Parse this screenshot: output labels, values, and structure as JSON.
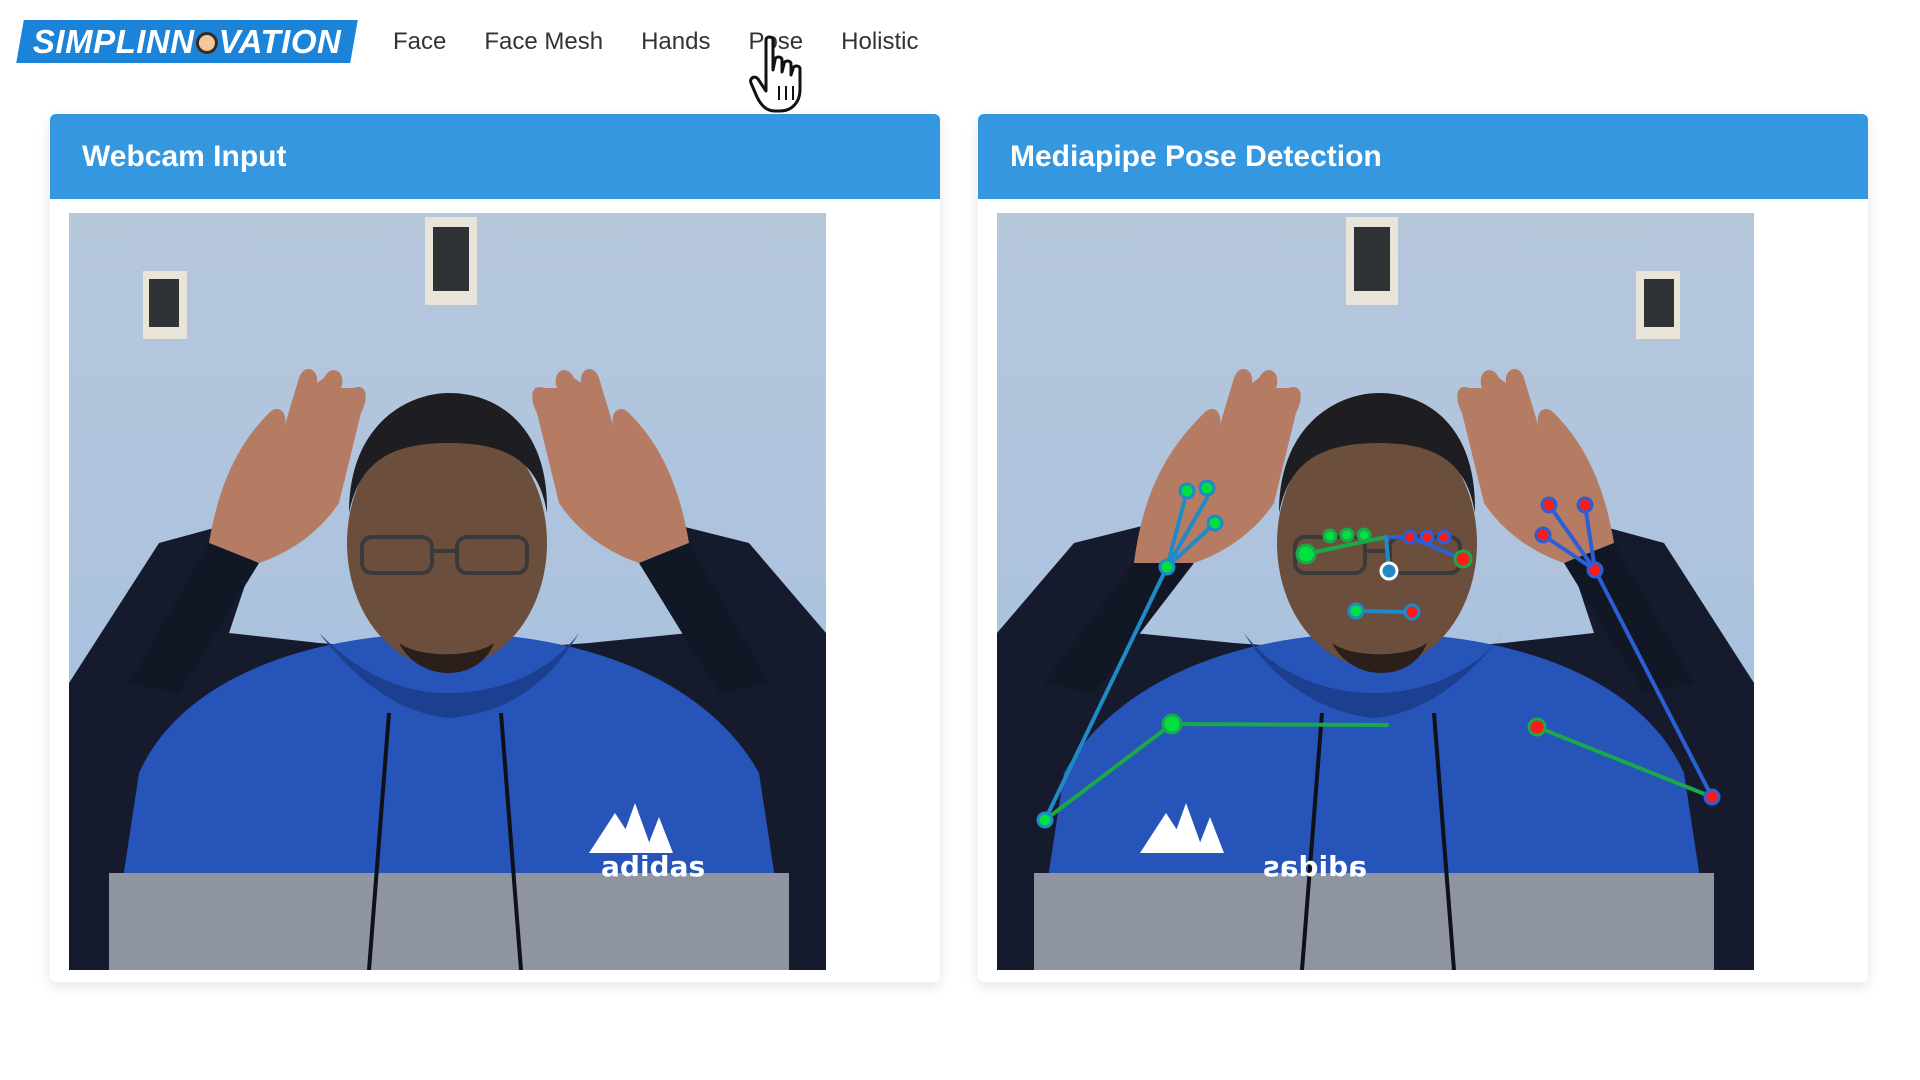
{
  "brand": {
    "text_before": "SIMPLINN",
    "text_after": "VATION"
  },
  "nav": {
    "items": [
      {
        "label": "Face"
      },
      {
        "label": "Face Mesh"
      },
      {
        "label": "Hands"
      },
      {
        "label": "Pose"
      },
      {
        "label": "Holistic"
      }
    ],
    "hovered": "Pose"
  },
  "panels": {
    "webcam": {
      "title": "Webcam Input"
    },
    "pose": {
      "title": "Mediapipe Pose Detection"
    }
  },
  "shirt_logo": {
    "left_panel": "adidas",
    "right_panel_mirrored": "adidas"
  },
  "colors": {
    "brand": "#1b84d8",
    "panel_header": "#3597df",
    "landmark_left": "#00e040",
    "landmark_right": "#ff1a1a",
    "connection_left": "#1aa84a",
    "connection_right": "#2b5fd6",
    "connection_mid": "#1f8ac7"
  },
  "icons": {
    "cursor": "hand-pointer-icon"
  }
}
